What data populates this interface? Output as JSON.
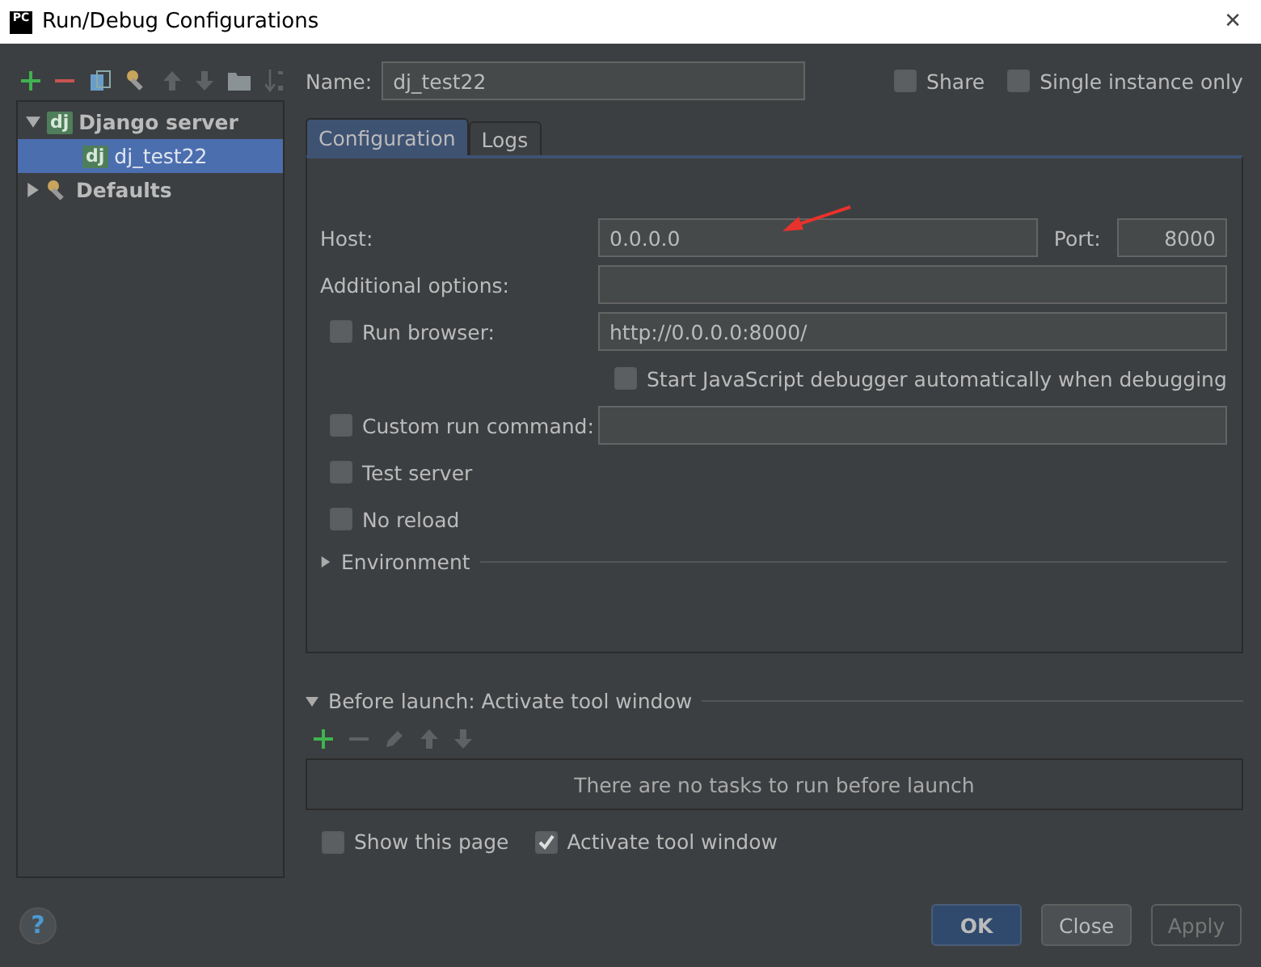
{
  "window": {
    "title": "Run/Debug Configurations",
    "icon_text": "PC",
    "close": "✕"
  },
  "tree": [
    {
      "label": "Django server",
      "badge": "dj",
      "expanded": true,
      "selected": false,
      "children": [
        {
          "label": "dj_test22",
          "badge": "dj",
          "selected": true
        }
      ]
    },
    {
      "label": "Defaults",
      "expanded": false,
      "selected": false
    }
  ],
  "name": {
    "label": "Name:",
    "value": "dj_test22"
  },
  "options": [
    {
      "label": "Share",
      "checked": false
    },
    {
      "label": "Single instance only",
      "checked": false
    }
  ],
  "tabs": [
    {
      "label": "Configuration",
      "selected": true
    },
    {
      "label": "Logs",
      "selected": false
    }
  ],
  "host": {
    "label": "Host:",
    "value": "0.0.0.0"
  },
  "port": {
    "label": "Port:",
    "value": "8000"
  },
  "additional_options": {
    "label": "Additional options:"
  },
  "run_browser": {
    "label": "Run browser:",
    "checked": false,
    "value": "http://0.0.0.0:8000/"
  },
  "js_debugger": {
    "label": "Start JavaScript debugger automatically when debugging",
    "checked": false
  },
  "custom_run": {
    "label": "Custom run command:",
    "checked": false
  },
  "flags": [
    {
      "label": "Test server",
      "checked": false
    },
    {
      "label": "No reload",
      "checked": false
    }
  ],
  "environment": {
    "label": "Environment",
    "expanded": false
  },
  "before_launch": {
    "label": "Before launch: Activate tool window",
    "expanded": true,
    "empty_text": "There are no tasks to run before launch"
  },
  "launch_options": [
    {
      "label": "Show this page",
      "checked": false
    },
    {
      "label": "Activate tool window",
      "checked": true
    }
  ],
  "help": "?",
  "buttons": [
    {
      "label": "OK",
      "kind": "primary",
      "disabled": false
    },
    {
      "label": "Close",
      "kind": "normal",
      "disabled": false
    },
    {
      "label": "Apply",
      "kind": "normal",
      "disabled": true
    }
  ]
}
